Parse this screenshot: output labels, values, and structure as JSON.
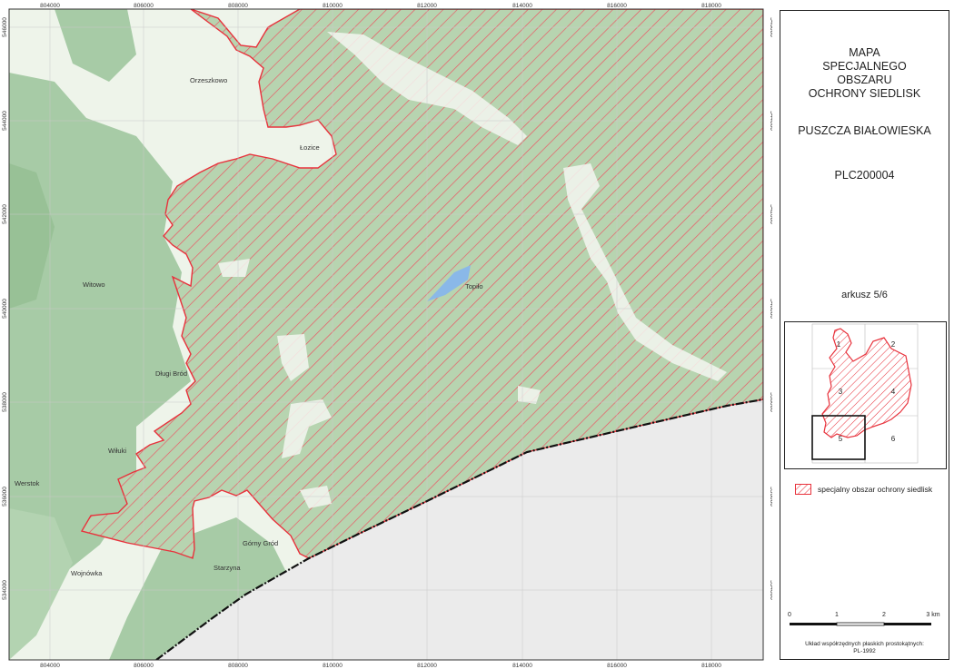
{
  "map": {
    "top_ticks": [
      "804000",
      "806000",
      "808000",
      "810000",
      "812000",
      "814000",
      "816000",
      "818000"
    ],
    "bottom_ticks": [
      "804000",
      "806000",
      "808000",
      "810000",
      "812000",
      "814000",
      "816000",
      "818000"
    ],
    "left_ticks": [
      "546000",
      "544000",
      "542000",
      "540000",
      "538000",
      "536000",
      "534000"
    ],
    "right_ticks": [
      "546000",
      "544000",
      "542000",
      "540000",
      "538000",
      "536000",
      "534000"
    ],
    "places": {
      "orzeszkowo": "Orzeszkowo",
      "lozice": "Łozice",
      "witowo": "Witowo",
      "topilo": "Topiło",
      "dlugi_brod": "Długi Bród",
      "wiluki": "Wiłuki",
      "werstok": "Werstok",
      "gorny_grod": "Górny Gród",
      "starzyna": "Starzyna",
      "wojnowka": "Wojnówka"
    }
  },
  "panel": {
    "title_line1": "MAPA",
    "title_line2": "SPECJALNEGO",
    "title_line3": "OBSZARU",
    "title_line4": "OCHRONY SIEDLISK",
    "name": "PUSZCZA BIAŁOWIESKA",
    "code": "PLC200004",
    "sheet": "arkusz 5/6",
    "index_labels": [
      "1",
      "2",
      "3",
      "4",
      "5",
      "6"
    ],
    "legend_label": "specjalny obszar ochrony siedlisk",
    "scale_labels": [
      "0",
      "1",
      "2",
      "3 km"
    ],
    "crs_line1": "Układ współrzędnych płaskich prostokątnych:",
    "crs_line2": "PL-1992"
  },
  "colors": {
    "forest": "#a7cba6",
    "open_land": "#f2f6ef",
    "area_outline": "#e8323c",
    "hatch": "#ee5060",
    "border_outside": "#ebebeb",
    "water": "#8ab8e8"
  }
}
